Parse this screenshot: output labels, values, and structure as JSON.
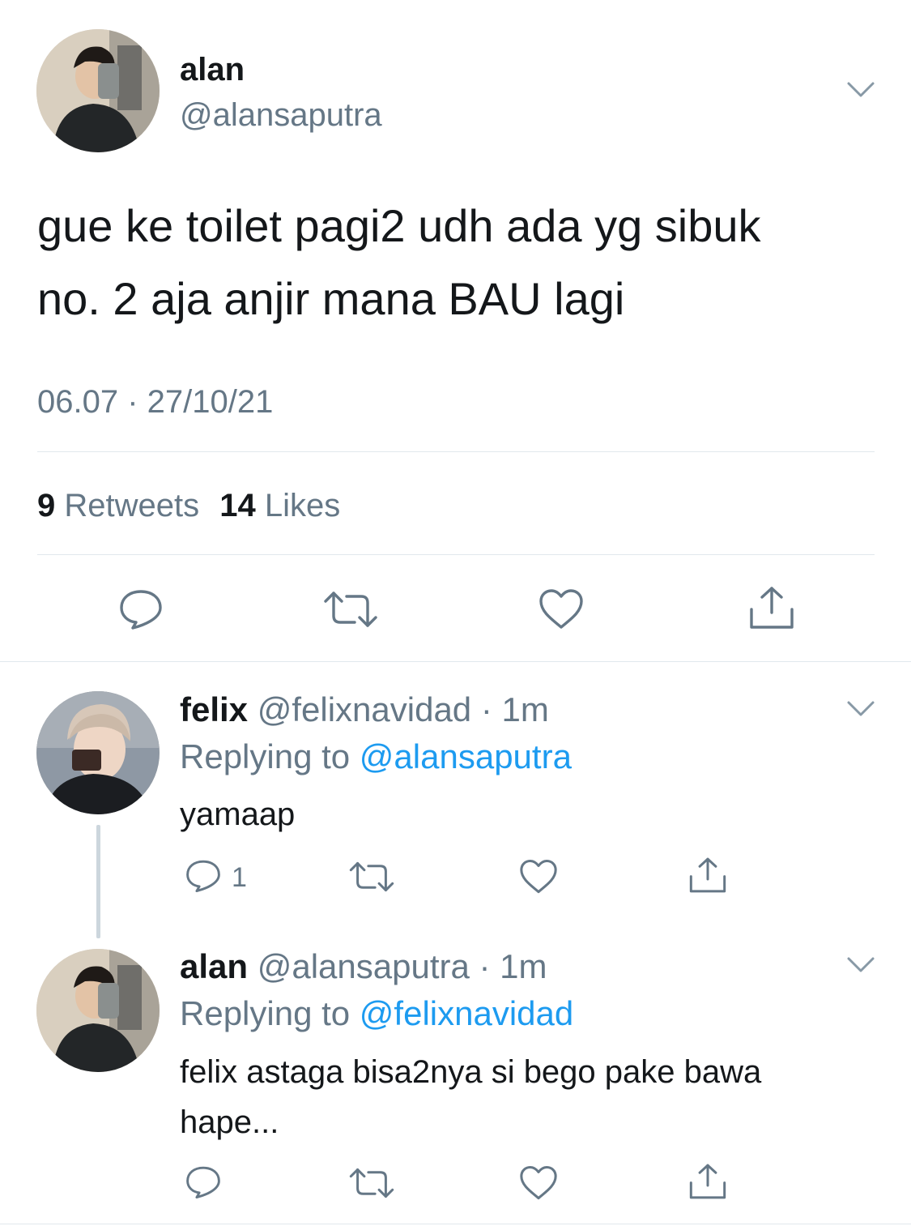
{
  "tweet": {
    "author_name": "alan",
    "author_handle": "@alansaputra",
    "text_line1": "gue ke toilet pagi2 udh ada yg sibuk",
    "text_line2": "no. 2 aja anjir mana BAU lagi",
    "timestamp": "06.07 · 27/10/21",
    "retweets_count": "9",
    "retweets_label": "Retweets",
    "likes_count": "14",
    "likes_label": "Likes"
  },
  "replies": [
    {
      "author_name": "felix",
      "author_handle": "@felixnavidad",
      "time": "· 1m",
      "replying_label": "Replying to",
      "replying_handle": "@alansaputra",
      "text": "yamaap",
      "reply_count": "1"
    },
    {
      "author_name": "alan",
      "author_handle": "@alansaputra",
      "time": "· 1m",
      "replying_label": "Replying to",
      "replying_handle": "@felixnavidad",
      "text_line1": "felix astaga bisa2nya si bego pake bawa",
      "text_line2": "hape..."
    }
  ],
  "icons": [
    "chevron-down-icon",
    "reply-icon",
    "retweet-icon",
    "like-icon",
    "share-icon"
  ],
  "colors": {
    "accent": "#1d9bf0",
    "secondary_text": "#657786",
    "divider": "#e1e8ed"
  }
}
